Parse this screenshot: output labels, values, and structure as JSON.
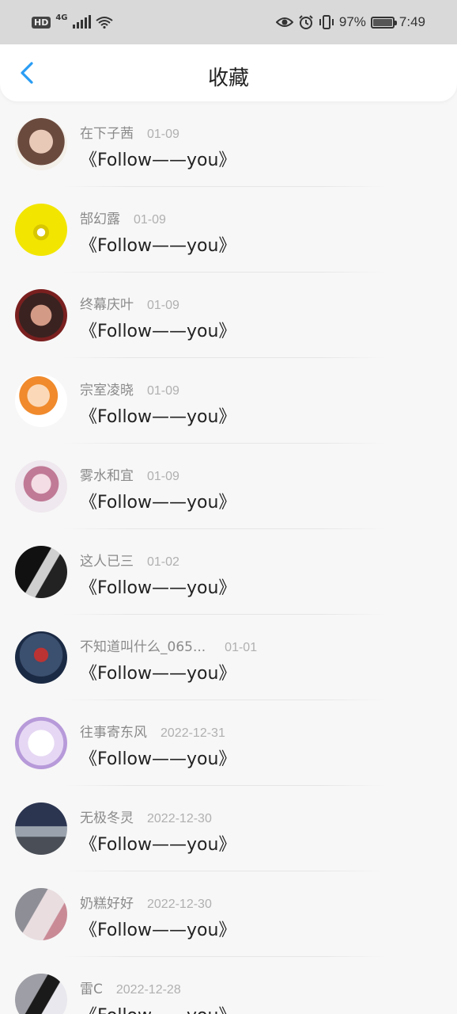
{
  "status_bar": {
    "hd": "HD",
    "network": "4G",
    "battery": "97%",
    "time": "7:49"
  },
  "header": {
    "title": "收藏",
    "back_icon": "chevron-left-icon"
  },
  "colors": {
    "accent": "#2a9df4",
    "name": "#8a8a8a",
    "date": "#b0b0b0"
  },
  "items": [
    {
      "name": "在下子茜",
      "date": "01-09",
      "message": "《Follow——you》"
    },
    {
      "name": "郜幻露",
      "date": "01-09",
      "message": "《Follow——you》"
    },
    {
      "name": "终幕庆叶",
      "date": "01-09",
      "message": "《Follow——you》"
    },
    {
      "name": "宗室凌晓",
      "date": "01-09",
      "message": "《Follow——you》"
    },
    {
      "name": "雾水和宜",
      "date": "01-09",
      "message": "《Follow——you》"
    },
    {
      "name": "这人已三",
      "date": "01-02",
      "message": "《Follow——you》"
    },
    {
      "name": "不知道叫什么_065...",
      "date": "01-01",
      "message": "《Follow——you》"
    },
    {
      "name": "往事寄东风",
      "date": "2022-12-31",
      "message": "《Follow——you》"
    },
    {
      "name": "无极冬灵",
      "date": "2022-12-30",
      "message": "《Follow——you》"
    },
    {
      "name": "奶糕好好",
      "date": "2022-12-30",
      "message": "《Follow——you》"
    },
    {
      "name": "雷C",
      "date": "2022-12-28",
      "message": "《Follow——you》"
    }
  ]
}
